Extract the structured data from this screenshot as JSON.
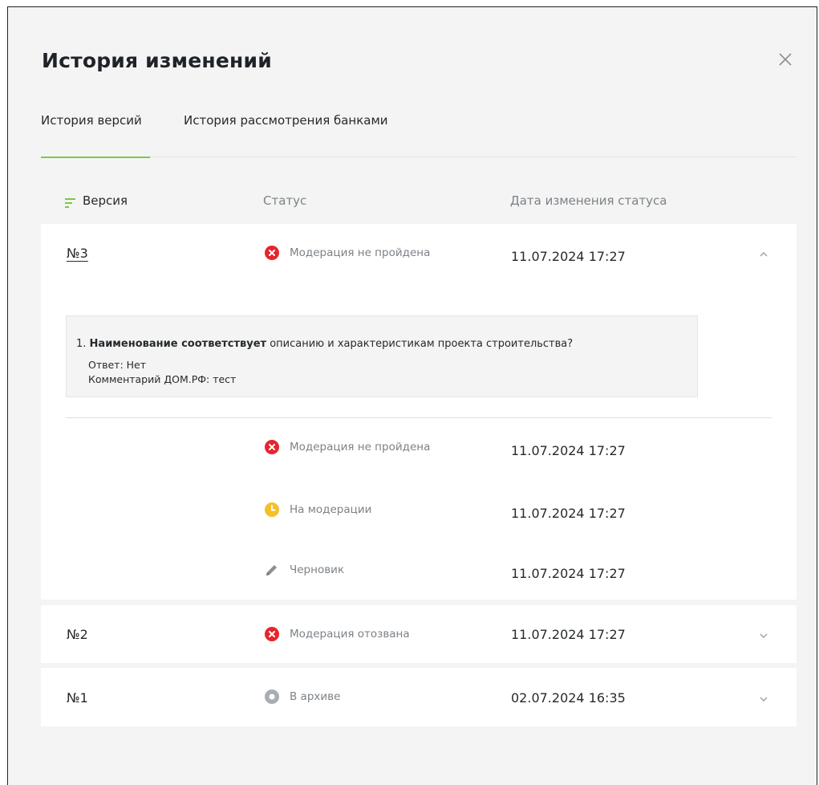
{
  "modal": {
    "title": "История изменений",
    "close_icon": "close-icon"
  },
  "tabs": [
    {
      "label": "История версий",
      "active": true
    },
    {
      "label": "История рассмотрения банками",
      "active": false
    }
  ],
  "table": {
    "headers": {
      "version": "Версия",
      "status": "Статус",
      "date": "Дата изменения статуса"
    },
    "sort_icon": "sort-icon"
  },
  "colors": {
    "accent": "#7cc843",
    "error": "#e5252c",
    "pending": "#f6bf29",
    "archive": "#a9adb0",
    "muted": "#7c8287"
  },
  "versions": [
    {
      "number": "№3",
      "status": "Модерация не пройдена",
      "status_icon": "error-icon",
      "date": "11.07.2024 17:27",
      "expanded": true,
      "answer": {
        "index": "1.",
        "question_bold": "Наименование соответствует",
        "question_rest": "описанию и характеристикам проекта строительства?",
        "answer_line": "Ответ: Нет",
        "comment_line": "Комментарий ДОМ.РФ: тест"
      },
      "history": [
        {
          "status": "Модерация не пройдена",
          "status_icon": "error-icon",
          "date": "11.07.2024 17:27"
        },
        {
          "status": "На модерации",
          "status_icon": "clock-icon",
          "date": "11.07.2024 17:27"
        },
        {
          "status": "Черновик",
          "status_icon": "pencil-icon",
          "date": "11.07.2024 17:27"
        }
      ]
    },
    {
      "number": "№2",
      "status": "Модерация отозвана",
      "status_icon": "error-icon",
      "date": "11.07.2024 17:27",
      "expanded": false
    },
    {
      "number": "№1",
      "status": "В архиве",
      "status_icon": "archive-icon",
      "date": "02.07.2024 16:35",
      "expanded": false
    }
  ]
}
